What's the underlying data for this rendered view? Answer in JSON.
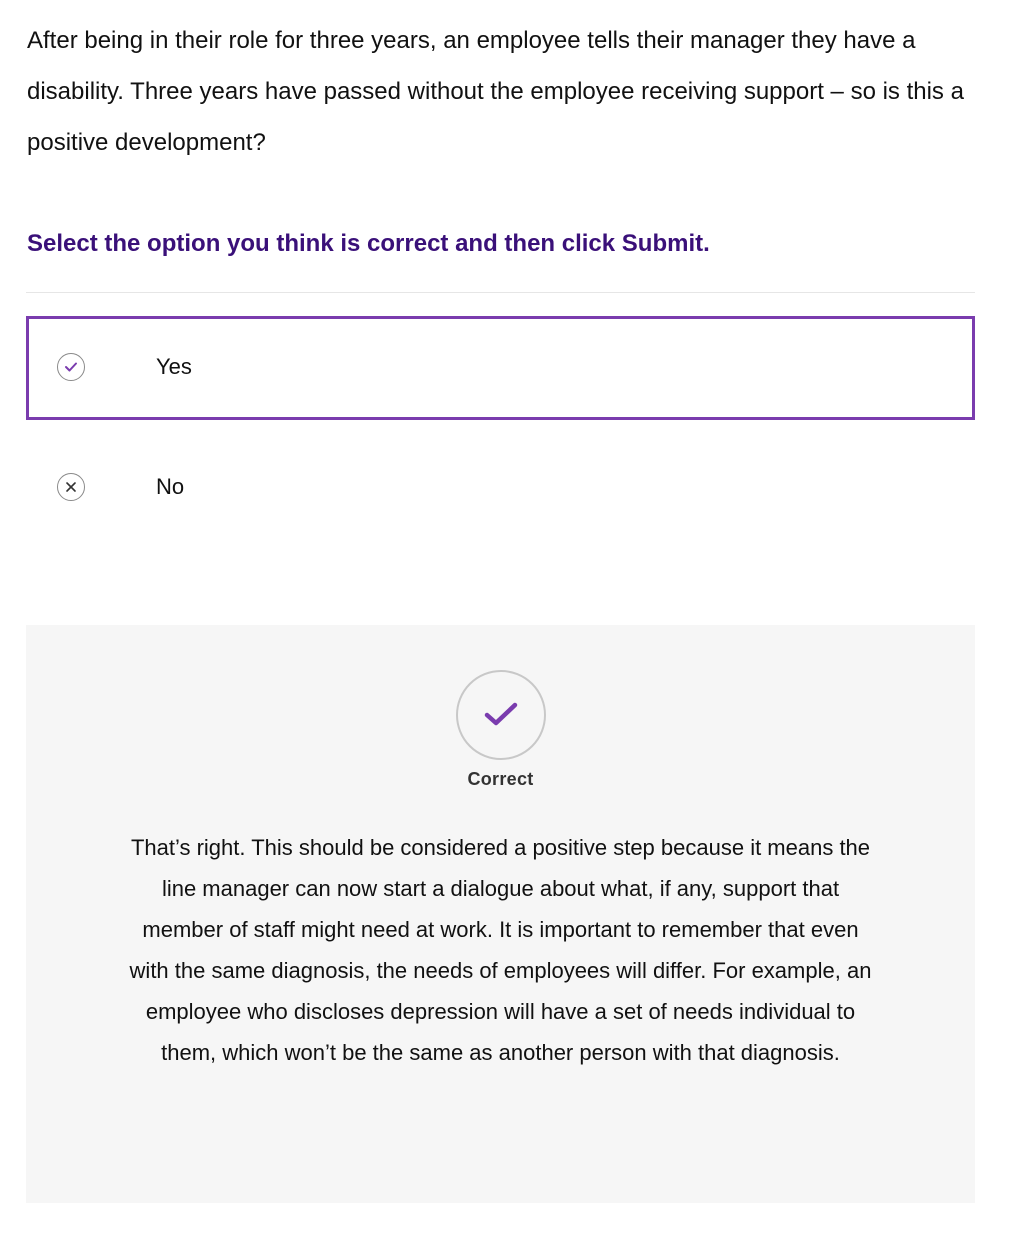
{
  "question": {
    "text": "After being in their role for three years, an employee tells their manager they have a disability. Three years have passed without the employee receiving support – so is this a positive development?"
  },
  "instruction": "Select the option you think is correct and then click Submit.",
  "options": [
    {
      "label": "Yes",
      "icon": "check-icon",
      "selected": true
    },
    {
      "label": "No",
      "icon": "x-icon",
      "selected": false
    }
  ],
  "feedback": {
    "icon": "check-icon",
    "status": "Correct",
    "explanation": "That’s right. This should be considered a positive step because it means the line manager can now start a dialogue about what, if any, support that member of staff might need at work. It is important to remember that even with the same diagnosis, the needs of employees will differ. For example, an employee who discloses depression will have a set of needs individual to them, which won’t be the same as another person with that diagnosis."
  },
  "colors": {
    "accent": "#7a3cae",
    "instruction": "#3a1079",
    "feedback_bg": "#f6f6f6"
  }
}
